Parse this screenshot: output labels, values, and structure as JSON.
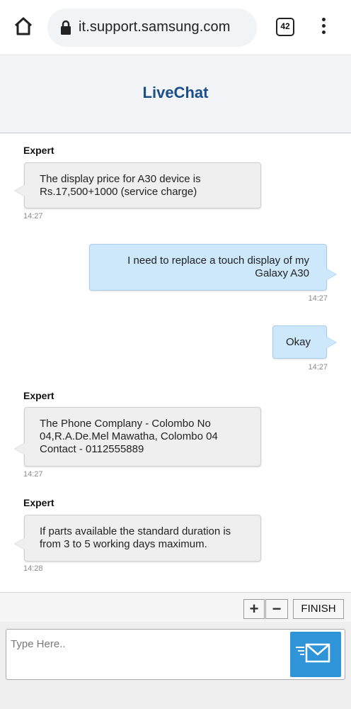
{
  "browser": {
    "url": "it.support.samsung.com",
    "tab_count": "42"
  },
  "header": {
    "title": "LiveChat"
  },
  "messages": [
    {
      "sender": "Expert",
      "text": "The display price for A30 device is\nRs.17,500+1000 (service charge)",
      "time": "14:27"
    },
    {
      "text": "I need to replace a touch display of my\nGalaxy A30",
      "time": "14:27"
    },
    {
      "text": "Okay",
      "time": "14:27"
    },
    {
      "sender": "Expert",
      "text": "The Phone Complany - Colombo No\n04,R.A.De.Mel Mawatha, Colombo 04\nContact - 0112555889",
      "time": "14:27"
    },
    {
      "sender": "Expert",
      "text": "If parts available the standard duration is\nfrom 3 to 5 working days maximum.",
      "time": "14:28"
    }
  ],
  "controls": {
    "zoom_in": "+",
    "zoom_out": "−",
    "finish": "FINISH"
  },
  "input": {
    "placeholder": "Type Here.."
  }
}
